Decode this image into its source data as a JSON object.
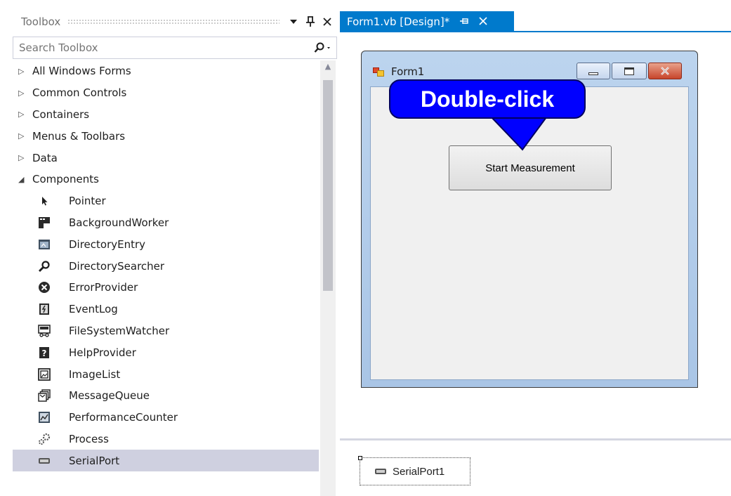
{
  "toolbox": {
    "title": "Toolbox",
    "search_placeholder": "Search Toolbox",
    "groups": [
      {
        "label": "All Windows Forms",
        "state": "collapsed"
      },
      {
        "label": "Common Controls",
        "state": "collapsed"
      },
      {
        "label": "Containers",
        "state": "collapsed"
      },
      {
        "label": "Menus & Toolbars",
        "state": "collapsed"
      },
      {
        "label": "Data",
        "state": "collapsed"
      },
      {
        "label": "Components",
        "state": "expanded"
      }
    ],
    "components": [
      {
        "label": "Pointer",
        "icon": "pointer-icon"
      },
      {
        "label": "BackgroundWorker",
        "icon": "background-worker-icon"
      },
      {
        "label": "DirectoryEntry",
        "icon": "directory-entry-icon"
      },
      {
        "label": "DirectorySearcher",
        "icon": "directory-searcher-icon"
      },
      {
        "label": "ErrorProvider",
        "icon": "error-provider-icon"
      },
      {
        "label": "EventLog",
        "icon": "event-log-icon"
      },
      {
        "label": "FileSystemWatcher",
        "icon": "file-system-watcher-icon"
      },
      {
        "label": "HelpProvider",
        "icon": "help-provider-icon"
      },
      {
        "label": "ImageList",
        "icon": "image-list-icon"
      },
      {
        "label": "MessageQueue",
        "icon": "message-queue-icon"
      },
      {
        "label": "PerformanceCounter",
        "icon": "performance-counter-icon"
      },
      {
        "label": "Process",
        "icon": "process-icon"
      },
      {
        "label": "SerialPort",
        "icon": "serial-port-icon",
        "selected": true
      }
    ]
  },
  "document_tab": {
    "label": "Form1.vb [Design]*"
  },
  "form": {
    "title": "Form1",
    "button_label": "Start Measurement"
  },
  "callout": {
    "text": "Double-click"
  },
  "tray": {
    "component_label": "SerialPort1"
  },
  "colors": {
    "accent": "#007acc",
    "callout": "#0000ff",
    "selection": "#cfd0e0"
  }
}
